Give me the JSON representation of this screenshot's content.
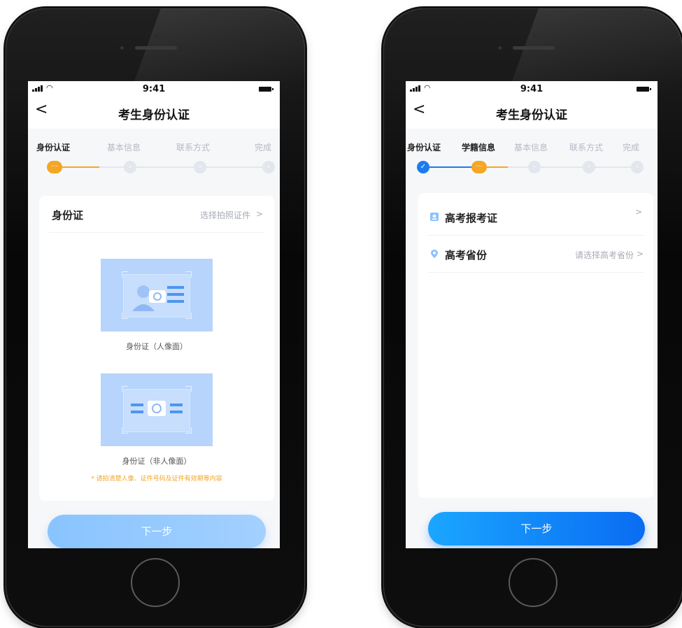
{
  "status": {
    "time": "9:41"
  },
  "left": {
    "nav": {
      "title": "考生身份认证",
      "back": "<"
    },
    "steps": [
      "身份认证",
      "基本信息",
      "联系方式",
      "完成"
    ],
    "current_step": 1,
    "card": {
      "row_label": "身份证",
      "row_value": "选择拍照证件",
      "row_chevron": ">",
      "front_caption": "身份证（人像面）",
      "back_caption": "身份证（非人像面）",
      "tip": "* 请拍清楚人像、证件号码及证件有效期等内容"
    },
    "next_button": "下一步"
  },
  "right": {
    "nav": {
      "title": "考生身份认证",
      "back": "<"
    },
    "steps": [
      "身份认证",
      "学籍信息",
      "基本信息",
      "联系方式",
      "完成"
    ],
    "current_step": 2,
    "rows": [
      {
        "label": "高考报考证",
        "value": "",
        "chevron": ">",
        "icon": "admission-ticket-icon"
      },
      {
        "label": "高考省份",
        "value": "请选择高考省份",
        "chevron": ">",
        "icon": "location-pin-icon"
      }
    ],
    "next_button": "下一步"
  },
  "colors": {
    "accent_orange": "#f5a623",
    "accent_blue": "#1a7cf0",
    "button_light": "#8fc6ff",
    "button_strong": "#0a6cf2"
  }
}
